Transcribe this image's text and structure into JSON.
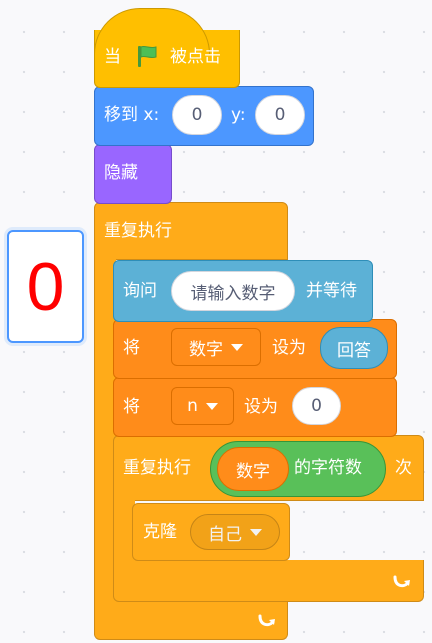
{
  "monitor": {
    "value": "0"
  },
  "blocks": {
    "hat": {
      "text_when": "当",
      "flag_icon": "green-flag-icon",
      "text_clicked": "被点击"
    },
    "goto": {
      "label": "移到 x:",
      "x_value": "0",
      "y_label": "y:",
      "y_value": "0"
    },
    "hide": {
      "label": "隐藏"
    },
    "repeat_forever": {
      "label": "重复执行",
      "loop_icon": "loop-arrow-icon"
    },
    "ask": {
      "label": "询问",
      "question": "请输入数字",
      "suffix": "并等待"
    },
    "set_var1": {
      "label": "将",
      "variable": "数字",
      "to_label": "设为",
      "value": "回答"
    },
    "set_var2": {
      "label": "将",
      "variable": "n",
      "to_label": "设为",
      "value": "0"
    },
    "repeat": {
      "label": "重复执行",
      "length_var": "数字",
      "length_text": "的字符数",
      "suffix": "次",
      "loop_icon": "loop-arrow-icon"
    },
    "clone": {
      "label": "克隆",
      "target": "自己"
    }
  },
  "colors": {
    "events": "#ffbf00",
    "motion": "#4c97ff",
    "looks": "#9966ff",
    "control": "#ffab19",
    "sensing": "#5cb1d6",
    "variables": "#ff8c1a",
    "operators": "#59c059"
  }
}
